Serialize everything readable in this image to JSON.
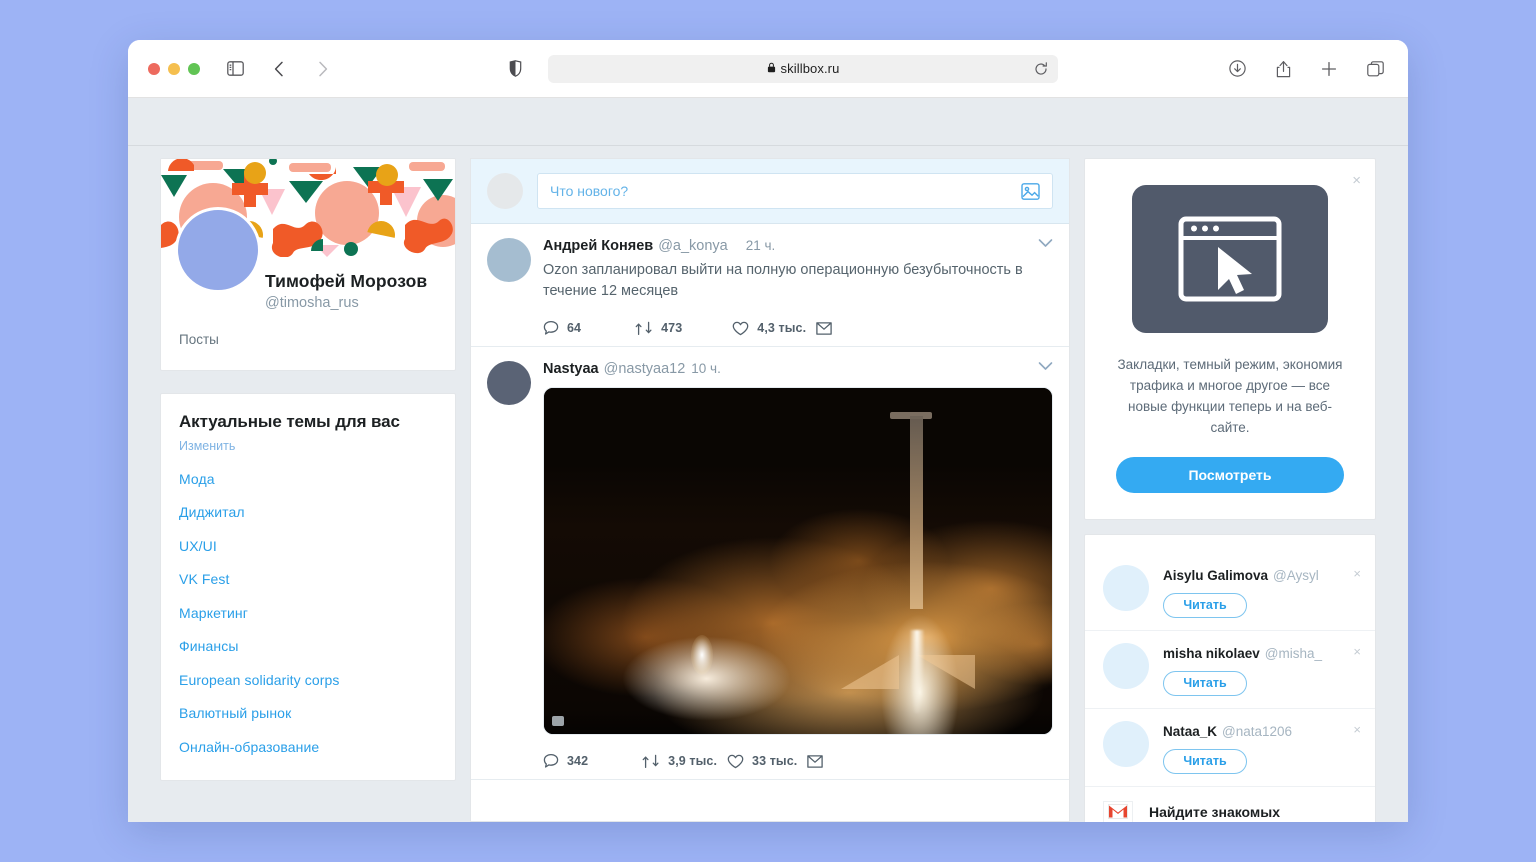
{
  "browser": {
    "url": "skillbox.ru",
    "lock_icon": "lock-icon",
    "reload_icon": "reload-icon",
    "sidebar_icon": "sidebar-icon",
    "back_icon": "back-chevron-icon",
    "forward_icon": "forward-chevron-icon",
    "shield_icon": "privacy-shield-icon",
    "downloads_icon": "downloads-icon",
    "share_icon": "share-icon",
    "newtab_icon": "new-tab-icon",
    "tabs_icon": "tab-overview-icon"
  },
  "profile": {
    "name": "Тимофей Морозов",
    "handle": "@timosha_rus",
    "tab_posts": "Посты",
    "avatar_color": "#93a9e8"
  },
  "topics": {
    "title": "Актуальные темы для вас",
    "edit": "Изменить",
    "items": [
      "Мода",
      "Диджитал",
      "UX/UI",
      "VK Fest",
      "Маркетинг",
      "Финансы",
      "European solidarity corps",
      "Валютный рынок",
      "Онлайн-образование"
    ]
  },
  "composer": {
    "placeholder": "Что нового?",
    "image_icon": "image-attach-icon"
  },
  "feed": {
    "tweets": [
      {
        "name": "Андрей Коняев",
        "handle": "@a_konya",
        "time": "21 ч.",
        "text": "Ozon запланировал выйти на полную операционную безубыточность в течение 12 месяцев",
        "replies": "64",
        "retweets": "473",
        "likes": "4,3 тыс.",
        "avatar_color": "#a5bdd0"
      },
      {
        "name": "Nastyaa",
        "handle": "@nastyaa12",
        "time": "10 ч.",
        "text": "",
        "replies": "342",
        "retweets": "3,9 тыс.",
        "likes": "33 тыс.",
        "avatar_color": "#5a6375",
        "media_alt": "Ночной запуск ракеты с оранжевым шлейфом"
      }
    ]
  },
  "promo": {
    "close": "×",
    "art_icon": "browser-window-cursor-icon",
    "text": "Закладки, темный режим, экономия трафика и многое другое — все новые функции теперь и на веб-сайте.",
    "button": "Посмотреть",
    "accent_color": "#34aaf2"
  },
  "suggestions": {
    "items": [
      {
        "name": "Aisylu Galimova",
        "handle": "@Aysyl",
        "button": "Читать",
        "close": "×"
      },
      {
        "name": "misha nikolaev",
        "handle": "@misha_",
        "button": "Читать",
        "close": "×"
      },
      {
        "name": "Nataa_K",
        "handle": "@nata1206",
        "button": "Читать",
        "close": "×"
      }
    ],
    "footer_label": "Найдите знакомых",
    "footer_icon": "gmail-icon"
  }
}
